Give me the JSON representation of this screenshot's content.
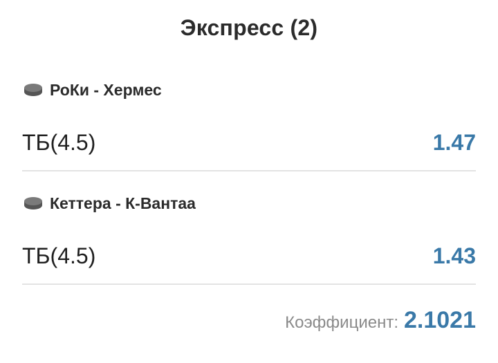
{
  "header": {
    "title": "Экспресс (2)"
  },
  "bets": [
    {
      "sport_icon": "hockey-puck-icon",
      "event": "РоКи - Хермес",
      "market": "ТБ(4.5)",
      "odds": "1.47"
    },
    {
      "sport_icon": "hockey-puck-icon",
      "event": "Кеттера - К-Вантаа",
      "market": "ТБ(4.5)",
      "odds": "1.43"
    }
  ],
  "summary": {
    "label": "Коэффициент:",
    "value": "2.1021"
  },
  "colors": {
    "accent": "#3a79a8",
    "text": "#222222",
    "muted": "#8a8a8a",
    "divider": "#e3e3e3"
  }
}
